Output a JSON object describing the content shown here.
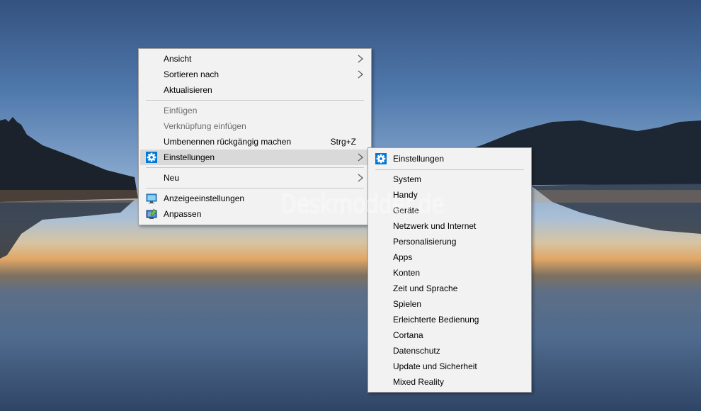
{
  "context_menu": {
    "items": [
      {
        "label": "Ansicht"
      },
      {
        "label": "Sortieren nach"
      },
      {
        "label": "Aktualisieren"
      },
      {
        "label": "Einfügen"
      },
      {
        "label": "Verknüpfung einfügen"
      },
      {
        "label": "Umbenennen rückgängig machen",
        "shortcut": "Strg+Z"
      },
      {
        "label": "Einstellungen"
      },
      {
        "label": "Neu"
      },
      {
        "label": "Anzeigeeinstellungen"
      },
      {
        "label": "Anpassen"
      }
    ]
  },
  "submenu": {
    "header": "Einstellungen",
    "items": [
      {
        "label": "System"
      },
      {
        "label": "Handy"
      },
      {
        "label": "Geräte"
      },
      {
        "label": "Netzwerk und Internet"
      },
      {
        "label": "Personalisierung"
      },
      {
        "label": "Apps"
      },
      {
        "label": "Konten"
      },
      {
        "label": "Zeit und Sprache"
      },
      {
        "label": "Spielen"
      },
      {
        "label": "Erleichterte Bedienung"
      },
      {
        "label": "Cortana"
      },
      {
        "label": "Datenschutz"
      },
      {
        "label": "Update und Sicherheit"
      },
      {
        "label": "Mixed Reality"
      }
    ]
  },
  "watermark": "Deskmodder.de",
  "icons": {
    "settings": "gear-icon",
    "display_settings": "monitor-icon",
    "personalize": "paint-brush-monitor-icon",
    "submenu_arrow": "chevron-right-icon"
  },
  "colors": {
    "menu_bg": "#f2f2f2",
    "highlight": "#d9d9d9",
    "disabled_text": "#6d6d6d",
    "accent_blue": "#0078d7"
  }
}
